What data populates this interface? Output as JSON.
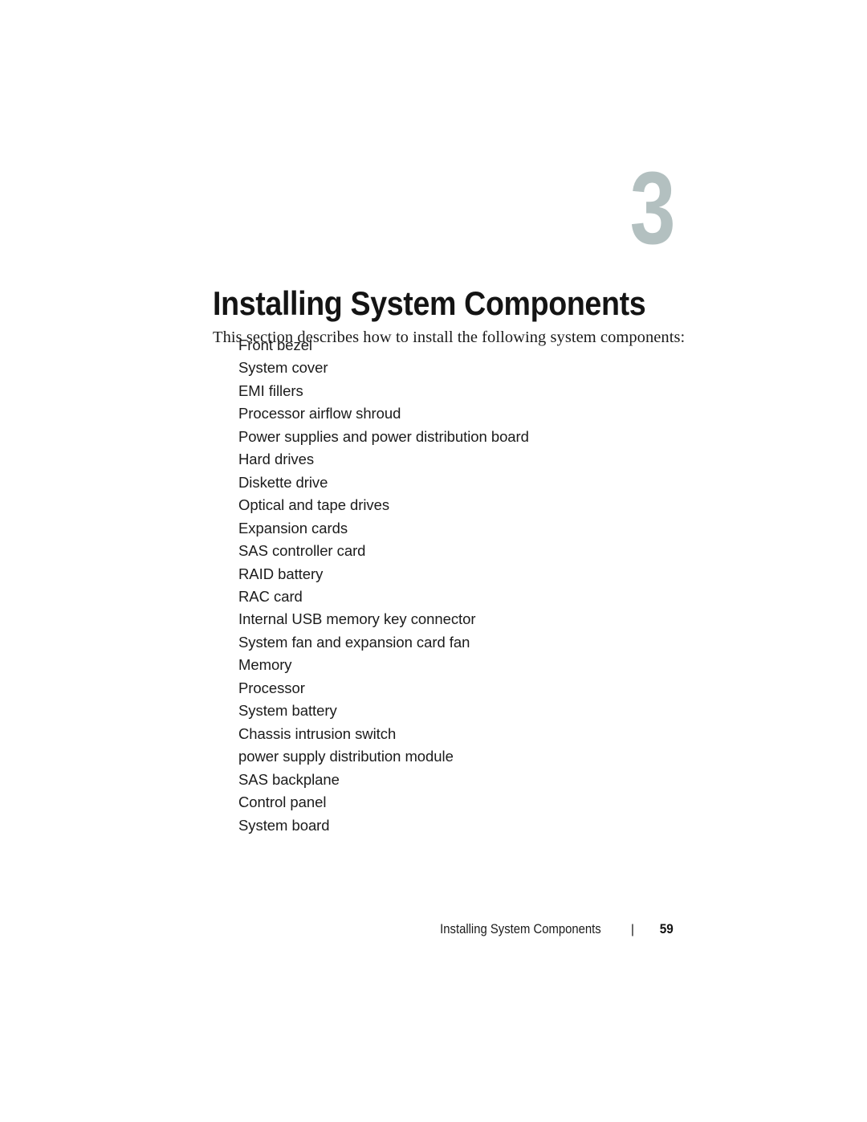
{
  "document": {
    "chapter_number": "3",
    "chapter_title": "Installing System Components",
    "intro_paragraph": "This section describes how to install the following system components:",
    "accent_color": "#b3c0c0",
    "text_color": "#1b1b1b"
  },
  "components": [
    {
      "label": "Front bezel"
    },
    {
      "label": "System cover"
    },
    {
      "label": "EMI fillers"
    },
    {
      "label": "Processor airflow shroud"
    },
    {
      "label": "Power supplies and power distribution board"
    },
    {
      "label": "Hard drives"
    },
    {
      "label": "Diskette drive"
    },
    {
      "label": "Optical and tape drives"
    },
    {
      "label": "Expansion cards"
    },
    {
      "label": "SAS controller card"
    },
    {
      "label": "RAID battery"
    },
    {
      "label": "RAC card"
    },
    {
      "label": "Internal USB memory key connector"
    },
    {
      "label": "System fan and expansion card fan"
    },
    {
      "label": "Memory"
    },
    {
      "label": "Processor"
    },
    {
      "label": "System battery"
    },
    {
      "label": "Chassis intrusion switch"
    },
    {
      "label": "power supply distribution module"
    },
    {
      "label": "SAS backplane"
    },
    {
      "label": "Control panel"
    },
    {
      "label": "System board"
    }
  ],
  "footer": {
    "chapter_name": "Installing System Components",
    "separator": "|",
    "page_number": "59"
  }
}
